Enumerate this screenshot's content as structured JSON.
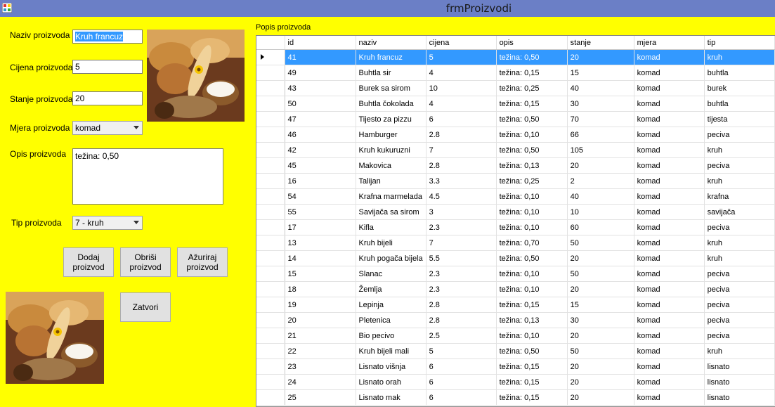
{
  "window": {
    "title": "frmProizvodi"
  },
  "form": {
    "naziv_label": "Naziv proizvoda",
    "naziv_value": "Kruh francuz",
    "cijena_label": "Cijena proizvoda",
    "cijena_value": "5",
    "stanje_label": "Stanje proizvoda",
    "stanje_value": "20",
    "mjera_label": "Mjera proizvoda",
    "mjera_value": "komad",
    "opis_label": "Opis proizvoda",
    "opis_value": "težina: 0,50",
    "tip_label": "Tip proizvoda",
    "tip_value": "7 - kruh",
    "btn_dodaj": "Dodaj proizvod",
    "btn_obrisi": "Obriši proizvod",
    "btn_azuriraj": "Ažuriraj proizvod",
    "btn_zatvori": "Zatvori"
  },
  "grid": {
    "caption": "Popis proizvoda",
    "columns": [
      "id",
      "naziv",
      "cijena",
      "opis",
      "stanje",
      "mjera",
      "tip"
    ],
    "rows": [
      [
        "41",
        "Kruh francuz",
        "5",
        "težina: 0,50",
        "20",
        "komad",
        "kruh"
      ],
      [
        "49",
        "Buhtla sir",
        "4",
        "težina: 0,15",
        "15",
        "komad",
        "buhtla"
      ],
      [
        "43",
        "Burek sa sirom",
        "10",
        "težina: 0,25",
        "40",
        "komad",
        "burek"
      ],
      [
        "50",
        "Buhtla čokolada",
        "4",
        "težina: 0,15",
        "30",
        "komad",
        "buhtla"
      ],
      [
        "47",
        "Tijesto za pizzu",
        "6",
        "težina: 0,50",
        "70",
        "komad",
        "tijesta"
      ],
      [
        "46",
        "Hamburger",
        "2.8",
        "težina: 0,10",
        "66",
        "komad",
        "peciva"
      ],
      [
        "42",
        "Kruh kukuruzni",
        "7",
        "težina: 0,50",
        "105",
        "komad",
        "kruh"
      ],
      [
        "45",
        "Makovica",
        "2.8",
        "težina: 0,13",
        "20",
        "komad",
        "peciva"
      ],
      [
        "16",
        "Talijan",
        "3.3",
        "težina: 0,25",
        "2",
        "komad",
        "kruh"
      ],
      [
        "54",
        "Krafna marmelada",
        "4.5",
        "težina: 0,10",
        "40",
        "komad",
        "krafna"
      ],
      [
        "55",
        "Savijača sa sirom",
        "3",
        "težina: 0,10",
        "10",
        "komad",
        "savijača"
      ],
      [
        "17",
        "Kifla",
        "2.3",
        "težina: 0,10",
        "60",
        "komad",
        "peciva"
      ],
      [
        "13",
        "Kruh bijeli",
        "7",
        "težina: 0,70",
        "50",
        "komad",
        "kruh"
      ],
      [
        "14",
        "Kruh pogača bijela",
        "5.5",
        "težina: 0,50",
        "20",
        "komad",
        "kruh"
      ],
      [
        "15",
        "Slanac",
        "2.3",
        "težina: 0,10",
        "50",
        "komad",
        "peciva"
      ],
      [
        "18",
        "Žemlja",
        "2.3",
        "težina: 0,10",
        "20",
        "komad",
        "peciva"
      ],
      [
        "19",
        "Lepinja",
        "2.8",
        "težina: 0,15",
        "15",
        "komad",
        "peciva"
      ],
      [
        "20",
        "Pletenica",
        "2.8",
        "težina: 0,13",
        "30",
        "komad",
        "peciva"
      ],
      [
        "21",
        "Bio pecivo",
        "2.5",
        "težina: 0,10",
        "20",
        "komad",
        "peciva"
      ],
      [
        "22",
        "Kruh bijeli mali",
        "5",
        "težina: 0,50",
        "50",
        "komad",
        "kruh"
      ],
      [
        "23",
        "Lisnato višnja",
        "6",
        "težina: 0,15",
        "20",
        "komad",
        "lisnato"
      ],
      [
        "24",
        "Lisnato orah",
        "6",
        "težina: 0,15",
        "20",
        "komad",
        "lisnato"
      ],
      [
        "25",
        "Lisnato mak",
        "6",
        "težina: 0,15",
        "20",
        "komad",
        "lisnato"
      ]
    ],
    "selected_row": 0
  },
  "colors": {
    "form_bg": "#ffff00",
    "titlebar": "#6b7fc6",
    "selection": "#3399ff"
  }
}
